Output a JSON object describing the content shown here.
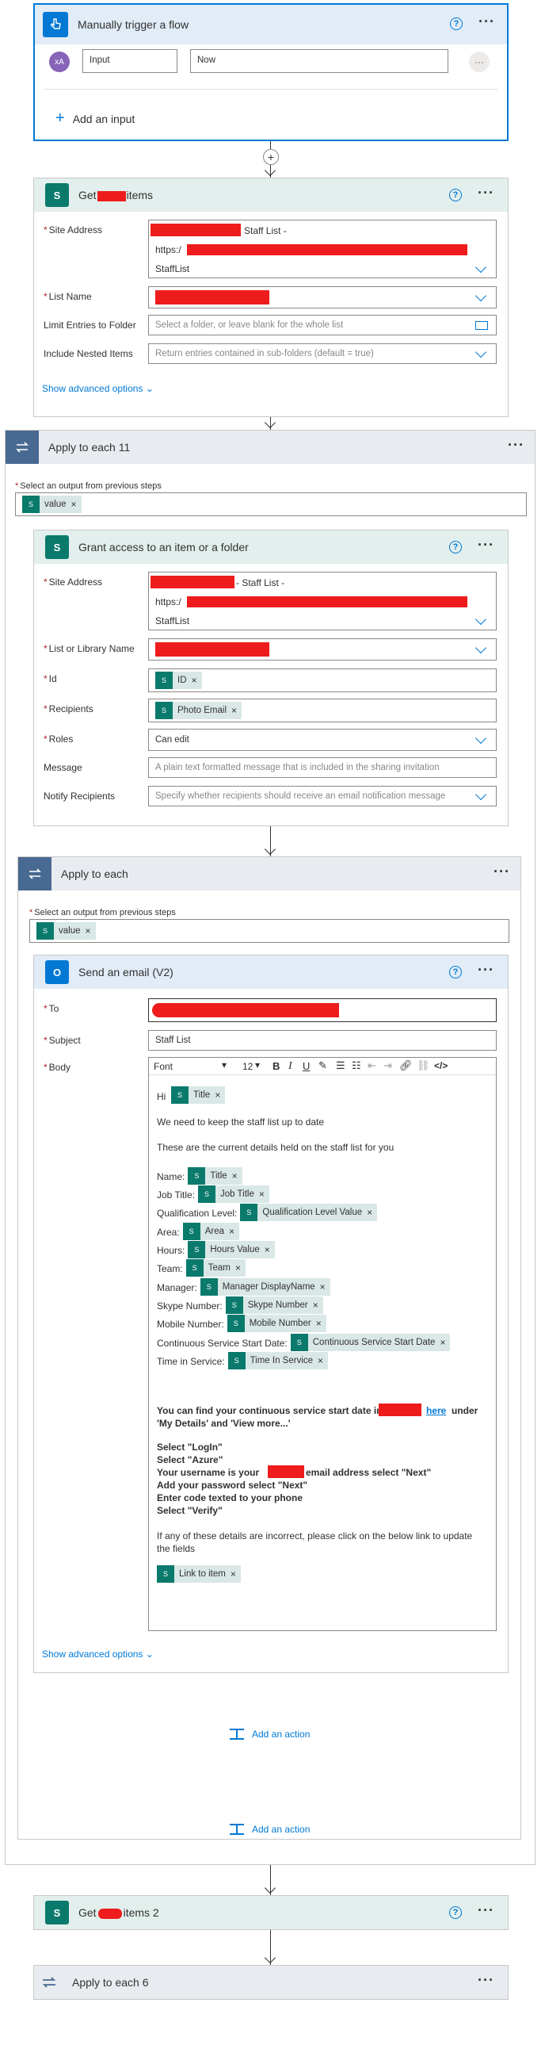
{
  "trigger": {
    "title": "Manually trigger a flow",
    "avatar": "xA",
    "input_name": "Input",
    "input_value": "Now",
    "add_input": "Add an input"
  },
  "get_items": {
    "title_prefix": "Get",
    "title_suffix": "items",
    "site_address_label": "Site Address",
    "site_line1": "Staff List -",
    "site_line2": "https:/",
    "site_line3": "StaffList",
    "list_name_label": "List Name",
    "limit_label": "Limit Entries to Folder",
    "limit_placeholder": "Select a folder, or leave blank for the whole list",
    "nested_label": "Include Nested Items",
    "nested_placeholder": "Return entries contained in sub-folders (default = true)",
    "advanced": "Show advanced options"
  },
  "apply_each_11": {
    "title": "Apply to each 11",
    "select_label": "Select an output from previous steps",
    "token": "value"
  },
  "grant": {
    "title": "Grant access to an item or a folder",
    "site_address_label": "Site Address",
    "site_line1": "- Staff List -",
    "site_line2": "https:/",
    "site_line3": "StaffList",
    "list_label": "List or Library Name",
    "id_label": "Id",
    "id_token": "ID",
    "recipients_label": "Recipients",
    "recipients_token": "Photo Email",
    "roles_label": "Roles",
    "roles_value": "Can edit",
    "message_label": "Message",
    "message_placeholder": "A plain text formatted message that is included in the sharing invitation",
    "notify_label": "Notify Recipients",
    "notify_placeholder": "Specify whether recipients should receive an email notification message"
  },
  "apply_each": {
    "title": "Apply to each",
    "select_label": "Select an output from previous steps",
    "token": "value"
  },
  "email": {
    "title": "Send an email (V2)",
    "to_label": "To",
    "subject_label": "Subject",
    "subject_value": "Staff List",
    "body_label": "Body",
    "font": "Font",
    "font_size": "12",
    "toolbar": [
      "B",
      "I",
      "U"
    ],
    "hi": "Hi",
    "title_token": "Title",
    "p1": "We need to keep the staff list up to date",
    "p2": "These are the current details held on the staff list for you",
    "rows": [
      {
        "label": "Name:",
        "token": "Title"
      },
      {
        "label": "Job Title:",
        "token": "Job Title"
      },
      {
        "label": "Qualification Level:",
        "token": "Qualification Level Value"
      },
      {
        "label": "Area:",
        "token": "Area"
      },
      {
        "label": "Hours:",
        "token": "Hours Value"
      },
      {
        "label": "Team:",
        "token": "Team"
      },
      {
        "label": "Manager:",
        "token": "Manager DisplayName"
      },
      {
        "label": "Skype Number:",
        "token": "Skype Number"
      },
      {
        "label": "Mobile Number:",
        "token": "Mobile Number"
      },
      {
        "label": "Continuous Service Start Date:",
        "token": "Continuous Service Start Date"
      },
      {
        "label": "Time in Service:",
        "token": "Time In Service"
      }
    ],
    "b1a": "You can find your continuous service start date in",
    "b1link": "here",
    "b1b": "under",
    "b1c": "'My Details' and 'View more...'",
    "steps": [
      "Select \"LogIn\"",
      "Select \"Azure\""
    ],
    "step3a": "Your username is your",
    "step3b": "email address select \"Next\"",
    "steps2": [
      "Add your password select \"Next\"",
      "Enter code texted to your phone",
      "Select \"Verify\""
    ],
    "p3a": "If any of these details are incorrect, please click on the below link to update",
    "p3b": "the fields",
    "link_token": "Link to item",
    "advanced": "Show advanced options"
  },
  "add_action": "Add an action",
  "get_items2": {
    "title_prefix": "Get",
    "title_suffix": "items 2"
  },
  "apply_each_6": {
    "title": "Apply to each 6"
  },
  "colors": {
    "accent": "#0078d4",
    "sharepoint": "#0a7a6c",
    "loop": "#486991",
    "redact": "#ee1c1c"
  }
}
